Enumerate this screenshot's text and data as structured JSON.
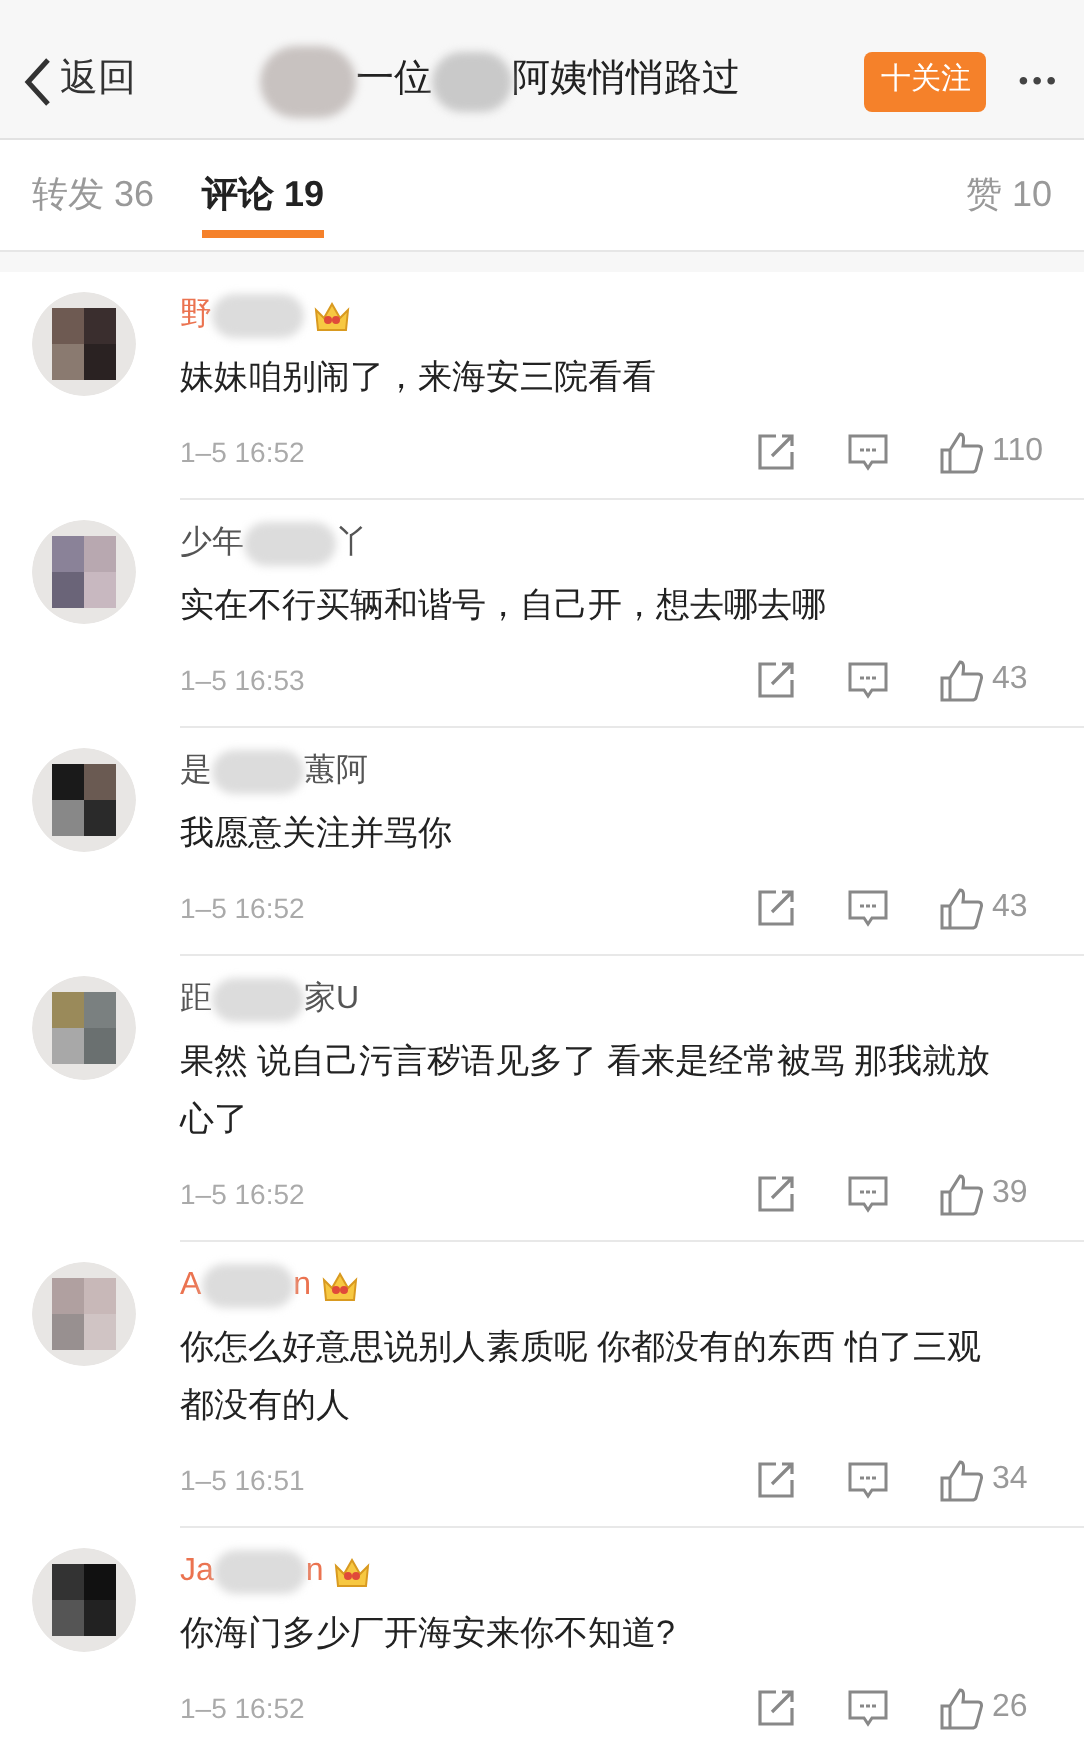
{
  "nav": {
    "back": "返回",
    "title_start": "一位",
    "title_end": "阿姨悄悄路过",
    "follow": "十关注",
    "more": "•••"
  },
  "tabs": [
    {
      "label": "转发 36",
      "selected": false
    },
    {
      "label": "评论 19",
      "selected": true
    }
  ],
  "likes_tab": "赞 10",
  "comments": [
    {
      "name_start": "野",
      "vip": true,
      "text": "妹妹咱别闹了，来海安三院看看",
      "time": "1–5 16:52",
      "likes": "110"
    },
    {
      "name_start": "少年",
      "name_end": "丫",
      "vip": false,
      "text": "实在不行买辆和谐号，自己开，想去哪去哪",
      "time": "1–5 16:53",
      "likes": "43"
    },
    {
      "name_start": "是",
      "name_end": "蕙阿",
      "vip": false,
      "text": "我愿意关注并骂你",
      "time": "1–5 16:52",
      "likes": "43"
    },
    {
      "name_start": "距",
      "name_end": "家U",
      "vip": false,
      "text": "果然  说自己污言秽语见多了 看来是经常被骂 那我就放心了",
      "time": "1–5 16:52",
      "likes": "39"
    },
    {
      "name_start": "A",
      "name_end": "n",
      "vip": true,
      "text": "你怎么好意思说别人素质呢 你都没有的东西 怕了三观都没有的人",
      "time": "1–5 16:51",
      "likes": "34"
    },
    {
      "name_start": "Ja",
      "name_end": "n",
      "vip": true,
      "text": "你海门多少厂开海安来你不知道?",
      "time": "1–5 16:52",
      "likes": "26"
    }
  ]
}
